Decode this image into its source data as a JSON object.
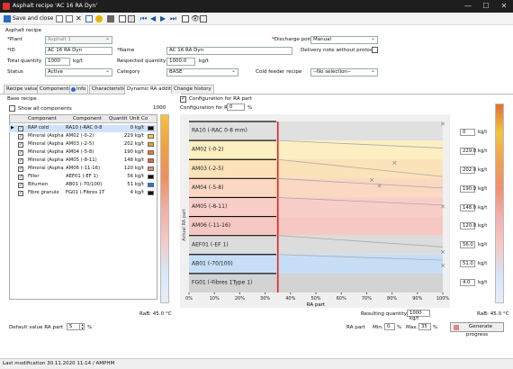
{
  "window": {
    "title": "Asphalt recipe 'AC 16 RA Dyn'",
    "minimize": "—",
    "maximize": "☐",
    "close": "✕"
  },
  "toolbar": {
    "save_close": "Save and close"
  },
  "group_title": "Asphalt recipe",
  "form": {
    "plant_label": "*Plant",
    "plant_value": "Asphalt 1",
    "id_label": "*ID",
    "id_value": "AC 16 RA Dyn",
    "name_label": "*Name",
    "name_value": "AC 16 RA Dyn",
    "discharge_label": "*Discharge point",
    "discharge_value": "Manual",
    "delivery_label": "Delivery note without protocol",
    "total_qty_label": "Total quantity",
    "total_qty_value": "1000",
    "total_qty_unit": "kg/t",
    "resp_qty_label": "Respected quantity",
    "resp_qty_value": "1000.0",
    "resp_qty_unit": "kg/t",
    "status_label": "Status",
    "status_value": "Active",
    "category_label": "Category",
    "category_value": "BASE",
    "cold_feeder_label": "Cold feeder recipe",
    "cold_feeder_value": "--No selection--"
  },
  "tabs": [
    "Recipe values",
    "Components",
    "Info",
    "Characteristics",
    "Dynamic RA addition",
    "Change history"
  ],
  "left": {
    "base_recipe": "Base recipe",
    "show_all": "Show all components",
    "top_value": "1000",
    "headers": [
      "Component",
      "Component",
      "Quantit",
      "Unit",
      "Co"
    ],
    "rows": [
      {
        "comp": "RAP cold",
        "id": "RA10 (-RAC 0-8",
        "qty": "0",
        "unit": "kg/t",
        "color": "#111111",
        "checked": true,
        "selected": true
      },
      {
        "comp": "Mineral (Aspha",
        "id": "AM02 (-0-2)",
        "qty": "229",
        "unit": "kg/t",
        "color": "#f0cc40",
        "checked": true,
        "selected": false
      },
      {
        "comp": "Mineral (Aspha",
        "id": "AM03 (-2-5)",
        "qty": "202",
        "unit": "kg/t",
        "color": "#e6a030",
        "checked": true,
        "selected": false
      },
      {
        "comp": "Mineral (Aspha",
        "id": "AM04 (-5-8)",
        "qty": "190",
        "unit": "kg/t",
        "color": "#e87a3a",
        "checked": true,
        "selected": false
      },
      {
        "comp": "Mineral (Aspha",
        "id": "AM05 (-8-11)",
        "qty": "148",
        "unit": "kg/t",
        "color": "#e8603a",
        "checked": true,
        "selected": false
      },
      {
        "comp": "Mineral (Aspha",
        "id": "AM06 (-11-16)",
        "qty": "120",
        "unit": "kg/t",
        "color": "#e88a7a",
        "checked": true,
        "selected": false
      },
      {
        "comp": "Filler",
        "id": "AEF01 (-EF 1)",
        "qty": "56",
        "unit": "kg/t",
        "color": "#111111",
        "checked": true,
        "selected": false
      },
      {
        "comp": "Bitumen",
        "id": "AB01 (-70/100)",
        "qty": "51",
        "unit": "kg/t",
        "color": "#1e7ad8",
        "checked": true,
        "selected": false
      },
      {
        "comp": "Fibre granule",
        "id": "FG01 (-Fibres 1T",
        "qty": "4",
        "unit": "kg/t",
        "color": "#111111",
        "checked": true,
        "selected": false
      }
    ],
    "rab_label": "RaB: 45.0 °C",
    "default_ra_label": "Default value RA part",
    "default_ra_value": "5",
    "default_ra_unit": "%"
  },
  "right": {
    "config_label": "Configuration for RA part",
    "config_for_ra": "Configuration for RA",
    "config_value": "0",
    "config_unit": "%",
    "rab_label": "RaB: 45.0 °C",
    "resulting_label": "Resulting quantity",
    "resulting_value": "1000 kg/t",
    "ra_part_label": "RA part",
    "min_label": "Min.",
    "min_value": "0",
    "max_label": "Max.",
    "max_value": "35",
    "pct": "%",
    "generate_label": "Generate progress",
    "side_values": [
      {
        "v": "0",
        "u": "kg/t"
      },
      {
        "v": "229.0",
        "u": "kg/t"
      },
      {
        "v": "202.0",
        "u": "kg/t"
      },
      {
        "v": "190.0",
        "u": "kg/t"
      },
      {
        "v": "148.0",
        "u": "kg/t"
      },
      {
        "v": "120.0",
        "u": "kg/t"
      },
      {
        "v": "56.0",
        "u": "kg/t"
      },
      {
        "v": "51.0",
        "u": "kg/t"
      },
      {
        "v": "4.0",
        "u": "kg/t"
      }
    ]
  },
  "chart_data": {
    "type": "area",
    "xlabel": "RA part",
    "ylabel": "Actual RA part",
    "x_ticks": [
      "0%",
      "10%",
      "20%",
      "30%",
      "40%",
      "50%",
      "60%",
      "70%",
      "80%",
      "90%",
      "100%"
    ],
    "marker_x": 35,
    "bands": [
      {
        "name": "RA10 (-RAC 0-8 mm)",
        "color": "#e0e0e0"
      },
      {
        "name": "AM02 (-0-2)",
        "color": "#fcefc2"
      },
      {
        "name": "AM03 (-2-5)",
        "color": "#fbe2b8"
      },
      {
        "name": "AM04 (-5-8)",
        "color": "#fad8c2"
      },
      {
        "name": "AM05 (-8-11)",
        "color": "#f8cfc8"
      },
      {
        "name": "AM06 (-11-16)",
        "color": "#f6c8c3"
      },
      {
        "name": "AEF01 (-EF 1)",
        "color": "#dcdcdc"
      },
      {
        "name": "AB01 (-70/100)",
        "color": "#c6dff7"
      },
      {
        "name": "FG01 (-Fibres 1Type 1)",
        "color": "#d3d3d3"
      }
    ]
  },
  "status_bar": "Last modification 30.11.2020 11:14 / AMPHM"
}
